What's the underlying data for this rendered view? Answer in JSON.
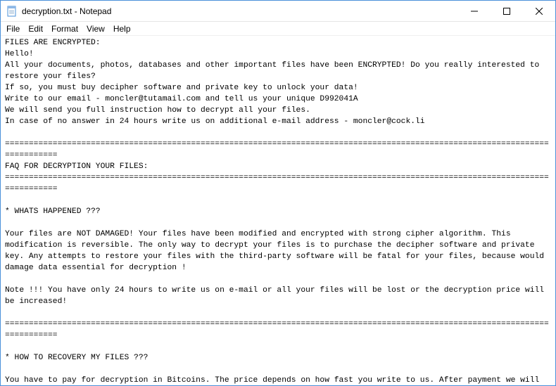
{
  "titlebar": {
    "title": "decryption.txt - Notepad"
  },
  "menubar": {
    "file": "File",
    "edit": "Edit",
    "format": "Format",
    "view": "View",
    "help": "Help"
  },
  "content": {
    "text": "FILES ARE ENCRYPTED:\nHello!\nAll your documents, photos, databases and other important files have been ENCRYPTED! Do you really interested to restore your files?\nIf so, you must buy decipher software and private key to unlock your data!\nWrite to our email - moncler@tutamail.com and tell us your unique D992041A\nWe will send you full instruction how to decrypt all your files.\nIn case of no answer in 24 hours write us on additional e-mail address - moncler@cock.li\n\n=============================================================================================================================\nFAQ FOR DECRYPTION YOUR FILES:\n=============================================================================================================================\n\n* WHATS HAPPENED ???\n\nYour files are NOT DAMAGED! Your files have been modified and encrypted with strong cipher algorithm. This modification is reversible. The only way to decrypt your files is to purchase the decipher software and private key. Any attempts to restore your files with the third-party software will be fatal for your files, because would damage data essential for decryption !\n\nNote !!! You have only 24 hours to write us on e-mail or all your files will be lost or the decryption price will be increased!\n\n=============================================================================================================================\n\n* HOW TO RECOVERY MY FILES ???\n\nYou have to pay for decryption in Bitcoins. The price depends on how fast you write to us. After payment we will send you the decipher software and private key that will decrypt all your files.\n\n=============================================================================================================================\n\n* FREE DECRYPTION !!!\n\nFree decryption as guarantee! If you don't believe in our service and you want to see a proof, you can ask us about test for decryption. You send us up to 5 modified files. Use file-sharing service and Win-Rar to send files for test. Files have to be less than 1 MB (non archived). Files should not be important! Don't send us databases, backups, large excel"
  }
}
